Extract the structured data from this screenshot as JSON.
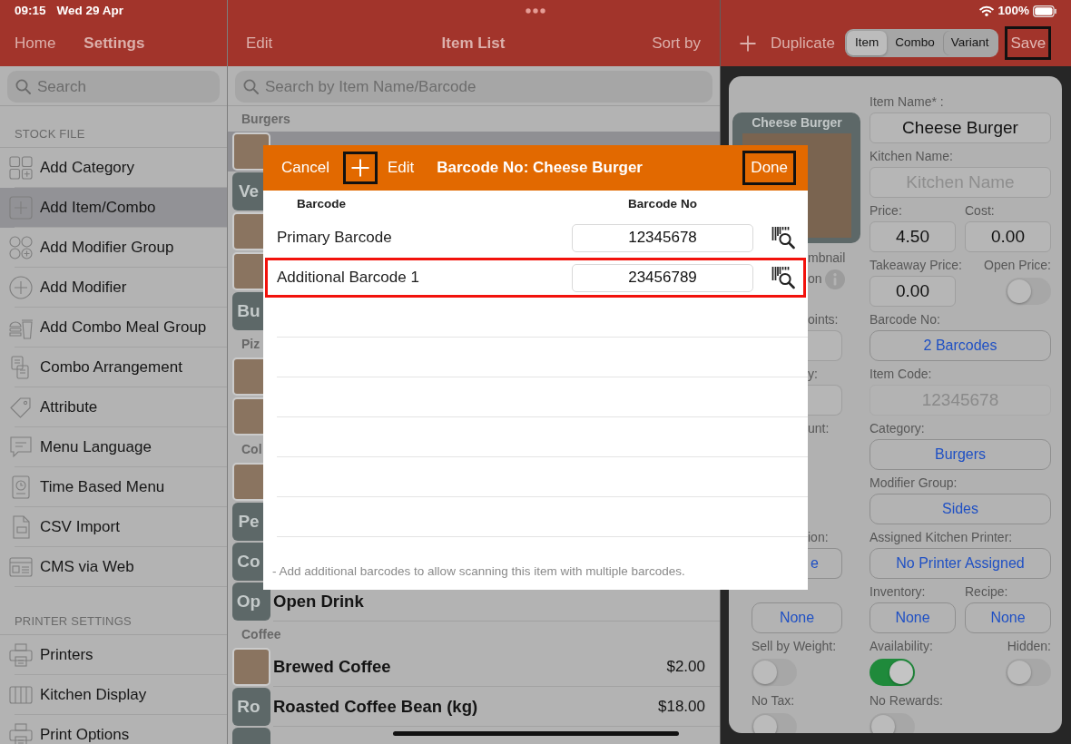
{
  "status_bar": {
    "time": "09:15",
    "date": "Wed 29 Apr",
    "battery": "100%"
  },
  "settings_panel": {
    "back": "Home",
    "title": "Settings",
    "search": {
      "placeholder": "Search"
    },
    "sections": [
      {
        "title": "STOCK FILE",
        "items": [
          {
            "label": "Add Category",
            "selected": false
          },
          {
            "label": "Add Item/Combo",
            "selected": true
          },
          {
            "label": "Add Modifier Group",
            "selected": false
          },
          {
            "label": "Add Modifier",
            "selected": false
          },
          {
            "label": "Add Combo Meal Group",
            "selected": false
          },
          {
            "label": "Combo Arrangement",
            "selected": false
          },
          {
            "label": "Attribute",
            "selected": false
          },
          {
            "label": "Menu Language",
            "selected": false
          },
          {
            "label": "Time Based Menu",
            "selected": false
          },
          {
            "label": "CSV Import",
            "selected": false
          },
          {
            "label": "CMS via Web",
            "selected": false
          }
        ]
      },
      {
        "title": "PRINTER SETTINGS",
        "items": [
          {
            "label": "Printers",
            "selected": false
          },
          {
            "label": "Kitchen Display",
            "selected": false
          },
          {
            "label": "Print Options",
            "selected": false
          }
        ]
      }
    ]
  },
  "item_list": {
    "edit": "Edit",
    "title": "Item List",
    "sort": "Sort by",
    "search": {
      "placeholder": "Search by Item Name/Barcode"
    },
    "groups": [
      {
        "title": "Burgers",
        "items": [
          {
            "kind": "photo",
            "selected": true
          },
          {
            "kind": "initials",
            "initials": "Ve",
            "selected": false
          },
          {
            "kind": "photo",
            "selected": false
          },
          {
            "kind": "photo",
            "selected": false
          },
          {
            "kind": "initials",
            "initials": "Bu",
            "selected": false
          }
        ]
      },
      {
        "title": "Piz",
        "items": [
          {
            "kind": "photo",
            "selected": false
          },
          {
            "kind": "photo",
            "selected": false
          }
        ]
      },
      {
        "title": "Col",
        "items": [
          {
            "kind": "photo",
            "selected": false
          },
          {
            "kind": "initials",
            "initials": "Pe",
            "selected": false
          },
          {
            "kind": "initials",
            "initials": "Co",
            "selected": false
          },
          {
            "kind": "initials",
            "initials": "Op",
            "name": "Open Drink",
            "selected": false
          }
        ]
      },
      {
        "title": "Coffee",
        "items": [
          {
            "kind": "photo",
            "name": "Brewed Coffee",
            "price": "$2.00",
            "selected": false
          },
          {
            "kind": "initials",
            "initials": "Ro",
            "name": "Roasted Coffee Bean (kg)",
            "price": "$18.00",
            "selected": false
          },
          {
            "kind": "initials",
            "selected": false
          }
        ]
      }
    ]
  },
  "item_editor": {
    "duplicate": "Duplicate",
    "segments": [
      {
        "label": "Item",
        "selected": true
      },
      {
        "label": "Combo",
        "selected": false
      },
      {
        "label": "Variant",
        "selected": false
      }
    ],
    "save": {
      "label": "Save",
      "highlighted": true
    },
    "thumbnail": {
      "title": "Cheese Burger"
    },
    "rows": [
      {
        "right": [
          {
            "kind": "text",
            "label": "Item Name* :",
            "value": "Cheese Burger",
            "disabled": false
          }
        ]
      },
      {
        "right": [
          {
            "kind": "text",
            "label": "Kitchen Name:",
            "placeholder": "Kitchen Name",
            "disabled": false
          }
        ]
      },
      {
        "right": [
          {
            "kind": "text",
            "label": "Price:",
            "value": "4.50",
            "disabled": false
          },
          {
            "kind": "text",
            "label": "Cost:",
            "value": "0.00",
            "disabled": false
          }
        ]
      },
      {
        "left": [
          {
            "kind": "label",
            "text": "mbnail"
          },
          {
            "kind": "info_label",
            "text": "on"
          }
        ],
        "right": [
          {
            "kind": "text",
            "label": "Takeaway Price:",
            "value": "0.00",
            "disabled": false
          },
          {
            "kind": "toggle",
            "label": "Open Price:",
            "on": false
          }
        ]
      },
      {
        "left": [
          {
            "kind": "label",
            "text": "oints:"
          },
          {
            "kind": "field"
          }
        ],
        "right": [
          {
            "kind": "picker",
            "label": "Barcode No:",
            "value": "2 Barcodes"
          }
        ]
      },
      {
        "left": [
          {
            "kind": "label",
            "text": "y:"
          },
          {
            "kind": "field"
          }
        ],
        "right": [
          {
            "kind": "text",
            "label": "Item Code:",
            "value": "12345678",
            "disabled": true
          }
        ]
      },
      {
        "left": [
          {
            "kind": "label",
            "text": "unt:"
          }
        ],
        "right": [
          {
            "kind": "picker",
            "label": "Category:",
            "value": "Burgers"
          }
        ]
      },
      {
        "right": [
          {
            "kind": "picker",
            "label": "Modifier Group:",
            "value": "Sides"
          }
        ]
      },
      {
        "left": [
          {
            "kind": "label",
            "text": "ion:"
          },
          {
            "kind": "picker",
            "value": "e"
          }
        ],
        "right": [
          {
            "kind": "picker",
            "label": "Assigned Kitchen Printer:",
            "value": "No Printer Assigned"
          }
        ]
      },
      {
        "left": [
          {
            "kind": "picker",
            "value": "None"
          }
        ],
        "right": [
          {
            "kind": "picker",
            "label": "Inventory:",
            "value": "None"
          },
          {
            "kind": "picker",
            "label": "Recipe:",
            "value": "None"
          }
        ]
      },
      {
        "left": [
          {
            "kind": "toggle",
            "label": "Sell by Weight:",
            "on": false
          }
        ],
        "right": [
          {
            "kind": "toggle",
            "label": "Availability:",
            "on": true
          },
          {
            "kind": "toggle",
            "label": "Hidden:",
            "on": false
          }
        ]
      },
      {
        "left": [
          {
            "kind": "toggle",
            "label": "No Tax:",
            "on": false
          }
        ],
        "right": [
          {
            "kind": "toggle",
            "label": "No Rewards:",
            "on": false
          }
        ]
      }
    ]
  },
  "barcode_dialog": {
    "cancel": "Cancel",
    "add": {
      "highlighted": true
    },
    "edit": "Edit",
    "title": "Barcode No: Cheese Burger",
    "done": {
      "label": "Done",
      "highlighted": true
    },
    "columns": [
      "Barcode",
      "Barcode No"
    ],
    "rows": [
      {
        "label": "Primary Barcode",
        "value": "12345678",
        "highlighted": false
      },
      {
        "label": "Additional Barcode 1",
        "value": "23456789",
        "highlighted": true
      }
    ],
    "note": "- Add additional barcodes to allow scanning this item with multiple barcodes."
  }
}
